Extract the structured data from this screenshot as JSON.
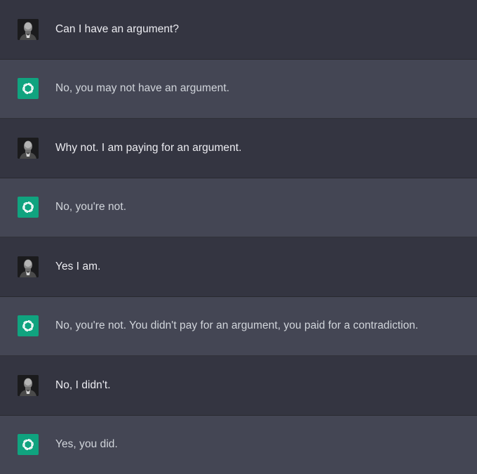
{
  "colors": {
    "user_row_bg": "#343541",
    "assistant_row_bg": "#444654",
    "assistant_avatar_bg": "#10a37f",
    "user_text": "#ececf1",
    "assistant_text": "#d1d5db"
  },
  "messages": [
    {
      "role": "user",
      "avatar_icon": "user-portrait-icon",
      "text": "Can I have an argument?"
    },
    {
      "role": "assistant",
      "avatar_icon": "openai-logo-icon",
      "text": "No, you may not have an argument."
    },
    {
      "role": "user",
      "avatar_icon": "user-portrait-icon",
      "text": "Why not. I am paying for an argument."
    },
    {
      "role": "assistant",
      "avatar_icon": "openai-logo-icon",
      "text": "No, you're not."
    },
    {
      "role": "user",
      "avatar_icon": "user-portrait-icon",
      "text": "Yes I am."
    },
    {
      "role": "assistant",
      "avatar_icon": "openai-logo-icon",
      "text": "No, you're not. You didn't pay for an argument, you paid for a contradiction."
    },
    {
      "role": "user",
      "avatar_icon": "user-portrait-icon",
      "text": "No, I didn't."
    },
    {
      "role": "assistant",
      "avatar_icon": "openai-logo-icon",
      "text": "Yes, you did."
    }
  ]
}
